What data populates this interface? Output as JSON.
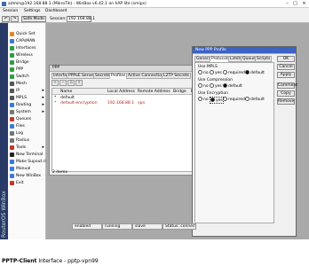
{
  "window": {
    "title": "admin@192.168.88.1 (MikroTik) - WinBox v6.42.1 on hAP lite (smips)"
  },
  "menu": [
    "Session",
    "Settings",
    "Dashboard"
  ],
  "toolbar": {
    "undo": "↶",
    "redo": "↷",
    "safe_mode": "Safe Mode",
    "session_label": "Session:",
    "session_value": "192.168.88.1"
  },
  "sidebar": {
    "vertical_label": "RouterOS WinBox",
    "items": [
      {
        "label": "Quick Set",
        "icon": "quick-set-icon",
        "color": "#d98b2a",
        "arrow": ""
      },
      {
        "label": "CAPsMAN",
        "icon": "capsman-icon",
        "color": "#3a7bd5",
        "arrow": ""
      },
      {
        "label": "Interfaces",
        "icon": "interfaces-icon",
        "color": "#2f9e44",
        "arrow": ""
      },
      {
        "label": "Wireless",
        "icon": "wireless-icon",
        "color": "#2f9e44",
        "arrow": ""
      },
      {
        "label": "Bridge",
        "icon": "bridge-icon",
        "color": "#2f9e44",
        "arrow": ""
      },
      {
        "label": "PPP",
        "icon": "ppp-icon",
        "color": "#2f9e44",
        "arrow": ""
      },
      {
        "label": "Switch",
        "icon": "switch-icon",
        "color": "#2f9e44",
        "arrow": ""
      },
      {
        "label": "Mesh",
        "icon": "mesh-icon",
        "color": "#555555",
        "arrow": ""
      },
      {
        "label": "IP",
        "icon": "ip-icon",
        "color": "#555555",
        "arrow": "▸"
      },
      {
        "label": "MPLS",
        "icon": "mpls-icon",
        "color": "#555555",
        "arrow": "▸"
      },
      {
        "label": "Routing",
        "icon": "routing-icon",
        "color": "#3a7bd5",
        "arrow": "▸"
      },
      {
        "label": "System",
        "icon": "system-icon",
        "color": "#777777",
        "arrow": "▸"
      },
      {
        "label": "Queues",
        "icon": "queues-icon",
        "color": "#c0392b",
        "arrow": ""
      },
      {
        "label": "Files",
        "icon": "files-icon",
        "color": "#3a7bd5",
        "arrow": ""
      },
      {
        "label": "Log",
        "icon": "log-icon",
        "color": "#777777",
        "arrow": ""
      },
      {
        "label": "Radius",
        "icon": "radius-icon",
        "color": "#777777",
        "arrow": ""
      },
      {
        "label": "Tools",
        "icon": "tools-icon",
        "color": "#c0392b",
        "arrow": "▸"
      },
      {
        "label": "New Terminal",
        "icon": "terminal-icon",
        "color": "#222222",
        "arrow": ""
      },
      {
        "label": "Make Supout.rif",
        "icon": "supout-icon",
        "color": "#3a7bd5",
        "arrow": ""
      },
      {
        "label": "Manual",
        "icon": "manual-icon",
        "color": "#3a7bd5",
        "arrow": ""
      },
      {
        "label": "New WinBox",
        "icon": "winbox-icon",
        "color": "#3a7bd5",
        "arrow": ""
      },
      {
        "label": "Exit",
        "icon": "exit-icon",
        "color": "#c0392b",
        "arrow": ""
      }
    ]
  },
  "ppp_window": {
    "title": "PPP",
    "tabs": [
      "Interface",
      "PPPoE Servers",
      "Secrets",
      "Profiles",
      "Active Connections",
      "L2TP Secrets"
    ],
    "active_tab": 3,
    "tools": [
      "+",
      "−",
      "▫",
      "▿"
    ],
    "columns": [
      "Name",
      "Local Address",
      "Remote Address",
      "Bridge",
      "Rate Limit..."
    ],
    "rows": [
      {
        "flag": "*",
        "name": "default",
        "local": "",
        "remote": "",
        "color": "#000000"
      },
      {
        "flag": "*",
        "name": "default-encryption",
        "local": "192.168.88.1",
        "remote": "vpn",
        "color": "#b02020"
      }
    ],
    "count": "2 items"
  },
  "profile_window": {
    "title": "New PPP Profile",
    "tabs": [
      "General",
      "Protocols",
      "Limits",
      "Queue",
      "Scripts"
    ],
    "active_tab": 1,
    "groups": [
      {
        "label": "Use MPLS",
        "options": [
          "no",
          "yes",
          "required",
          "default"
        ],
        "selected": 3
      },
      {
        "label": "Use Compression",
        "options": [
          "no",
          "yes",
          "default"
        ],
        "selected": 2
      },
      {
        "label": "Use Encryption",
        "options": [
          "no",
          "yes",
          "required",
          "default"
        ],
        "selected": 1
      }
    ],
    "buttons": [
      "OK",
      "Cancel",
      "Apply",
      "Comment",
      "Copy",
      "Remove"
    ]
  },
  "statusbar": [
    "enabled",
    "running",
    "slave",
    "Status: connected"
  ],
  "footer": {
    "bold": "PPTP-Client",
    "rest": " Interface - pptp-vpn99"
  }
}
